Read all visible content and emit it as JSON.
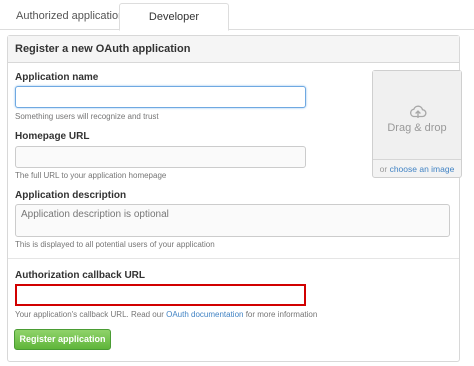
{
  "tabs": [
    {
      "label": "Authorized applications",
      "active": false
    },
    {
      "label": "Developer applications",
      "active": true
    }
  ],
  "panel": {
    "title": "Register a new OAuth application"
  },
  "form": {
    "app_name": {
      "label": "Application name",
      "value": "",
      "help": "Something users will recognize and trust"
    },
    "homepage": {
      "label": "Homepage URL",
      "value": "",
      "help": "The full URL to your application homepage"
    },
    "description": {
      "label": "Application description",
      "placeholder": "Application description is optional",
      "help": "This is displayed to all potential users of your application"
    },
    "callback": {
      "label": "Authorization callback URL",
      "value": "",
      "help_prefix": "Your application's callback URL. Read our ",
      "help_link": "OAuth documentation",
      "help_suffix": " for more information"
    }
  },
  "upload": {
    "icon": "cloud-upload-icon",
    "zone_text": "Drag & drop",
    "foot_prefix": "or ",
    "foot_link": "choose an image"
  },
  "submit_label": "Register application",
  "colors": {
    "primary_button": "#6cc644",
    "error_border": "#d10000",
    "link": "#4183c4",
    "focus_border": "#6fa9e1"
  }
}
